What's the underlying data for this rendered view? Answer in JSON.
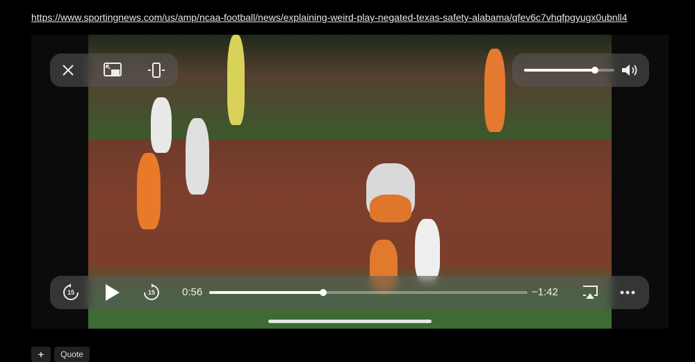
{
  "url": "https://www.sportingnews.com/us/amp/ncaa-football/news/explaining-weird-play-negated-texas-safety-alabama/qfev6c7vhqfpgyugx0ubnll4",
  "player": {
    "current_time": "0:56",
    "remaining_time": "−1:42",
    "progress_fraction": 0.29,
    "volume_fraction": 0.78,
    "skip_back_label": "15",
    "skip_forward_label": "15"
  },
  "footer": {
    "add_label": "+",
    "quote_label": "Quote"
  },
  "icons": [
    "close-icon",
    "picture-in-picture-icon",
    "resize-icon",
    "volume-icon",
    "skip-back-icon",
    "play-icon",
    "skip-forward-icon",
    "airplay-icon",
    "more-icon"
  ]
}
